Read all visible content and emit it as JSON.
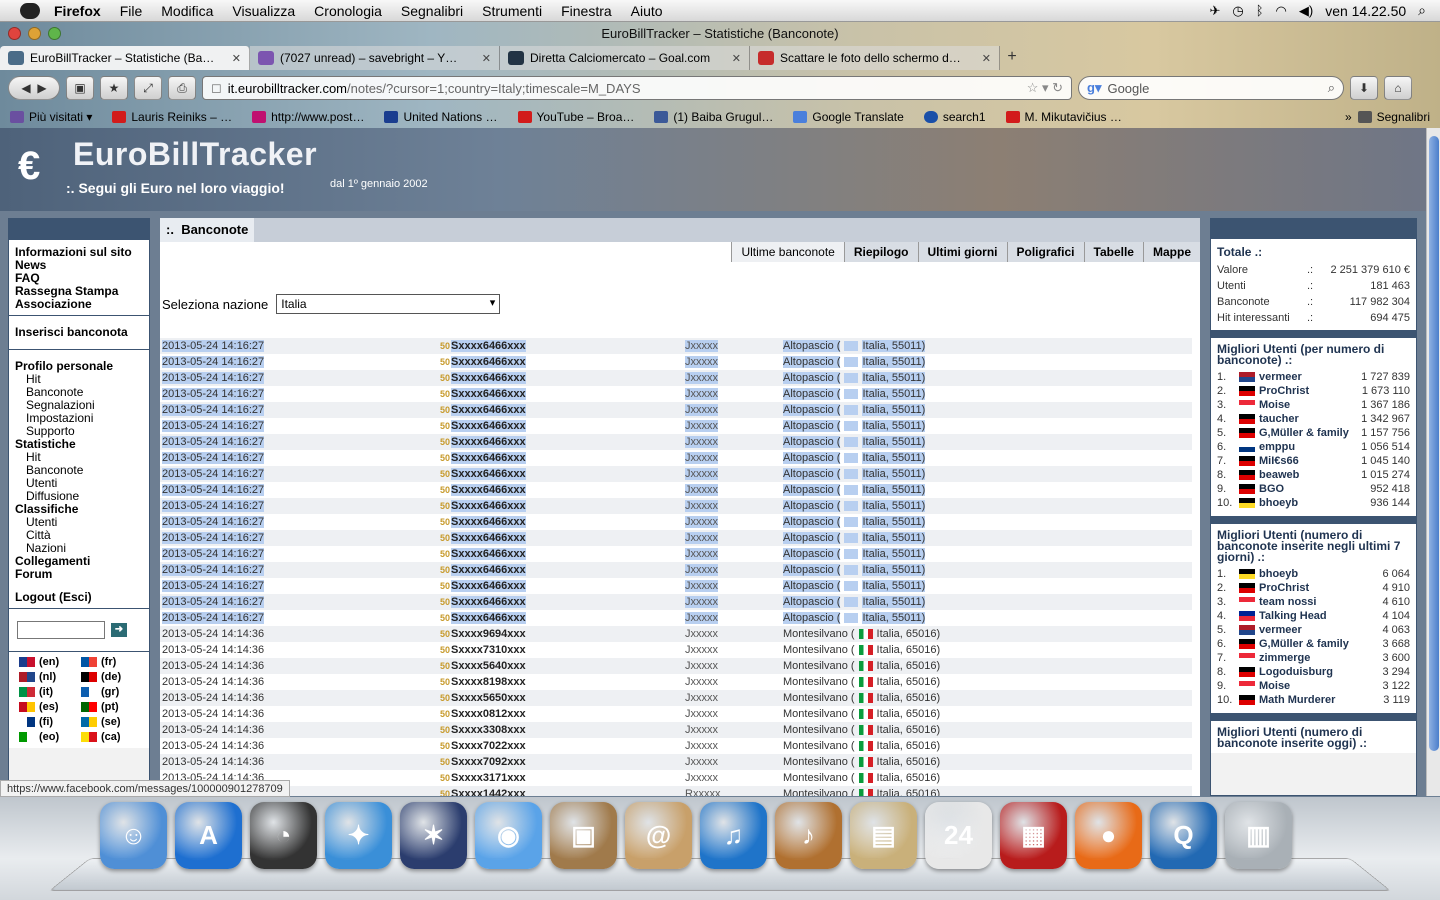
{
  "menubar": {
    "app": "Firefox",
    "items": [
      "File",
      "Modifica",
      "Visualizza",
      "Cronologia",
      "Segnalibri",
      "Strumenti",
      "Finestra",
      "Aiuto"
    ],
    "clock": "ven 14.22.50"
  },
  "window": {
    "title": "EuroBillTracker – Statistiche (Banconote)"
  },
  "tabs": [
    {
      "title": "EuroBillTracker – Statistiche (Ba…",
      "color": "#4b6c88"
    },
    {
      "title": "(7027 unread) – savebright – Y…",
      "color": "#7c55b0"
    },
    {
      "title": "Diretta Calciomercato – Goal.com",
      "color": "#223344"
    },
    {
      "title": "Scattare le foto dello schermo d…",
      "color": "#c62b2b"
    }
  ],
  "newtab": "+",
  "navbar": {
    "url_domain": "it.eurobilltracker.com",
    "url_path": "/notes/?cursor=1;country=Italy;timescale=M_DAYS",
    "search_placeholder": "Google"
  },
  "bookmarks": [
    {
      "label": "Più visitati ▾",
      "color": "#6a4fa0"
    },
    {
      "label": "Lauris Reiniks – …",
      "color": "#d21b1b"
    },
    {
      "label": "http://www.post…",
      "color": "#c01070"
    },
    {
      "label": "United Nations …",
      "color": "#1a3d8f"
    },
    {
      "label": "YouTube – Broa…",
      "color": "#d21b1b"
    },
    {
      "label": "(1) Baiba Grugul…",
      "color": "#3b5998"
    },
    {
      "label": "Google Translate",
      "color": "#4a7fdc"
    },
    {
      "label": "search1",
      "color": "#1a4fa8"
    },
    {
      "label": "M. Mikutavičius …",
      "color": "#d21b1b"
    }
  ],
  "bookmarks_more": "»",
  "bookmarks_menu": "Segnalibri",
  "banner": {
    "brand": "EuroBillTracker",
    "tagline": ":. Segui gli Euro nel loro viaggio!",
    "since": "dal 1º gennaio 2002"
  },
  "leftnav": {
    "info": [
      "Informazioni sul sito",
      "News",
      "FAQ",
      "Rassegna Stampa",
      "Associazione"
    ],
    "insert": "Inserisci banconota",
    "profile_title": "Profilo personale",
    "profile": [
      "Hit",
      "Banconote",
      "Segnalazioni",
      "Impostazioni",
      "Supporto"
    ],
    "stats_title": "Statistiche",
    "stats": [
      "Hit",
      "Banconote",
      "Utenti",
      "Diffusione"
    ],
    "class_title": "Classifiche",
    "classes": [
      "Utenti",
      "Città",
      "Nazioni"
    ],
    "links": [
      "Collegamenti",
      "Forum"
    ],
    "logout": "Logout (Esci)",
    "go": "➜",
    "langs": [
      {
        "code": "(en)",
        "c": [
          "#1b3d8c",
          "#c8102e"
        ]
      },
      {
        "code": "(fr)",
        "c": [
          "#0055a4",
          "#ef4135"
        ]
      },
      {
        "code": "(nl)",
        "c": [
          "#ae1c28",
          "#21468b"
        ]
      },
      {
        "code": "(de)",
        "c": [
          "#000000",
          "#dd0000"
        ]
      },
      {
        "code": "(it)",
        "c": [
          "#009246",
          "#ce2b37"
        ]
      },
      {
        "code": "(gr)",
        "c": [
          "#0d5eaf",
          "#ffffff"
        ]
      },
      {
        "code": "(es)",
        "c": [
          "#c60b1e",
          "#ffc400"
        ]
      },
      {
        "code": "(pt)",
        "c": [
          "#006600",
          "#ff0000"
        ]
      },
      {
        "code": "(fi)",
        "c": [
          "#ffffff",
          "#003580"
        ]
      },
      {
        "code": "(se)",
        "c": [
          "#006aa7",
          "#fecc00"
        ]
      },
      {
        "code": "(eo)",
        "c": [
          "#009900",
          "#ffffff"
        ]
      },
      {
        "code": "(ca)",
        "c": [
          "#fcdd09",
          "#da121a"
        ]
      }
    ]
  },
  "main": {
    "title": "Banconote",
    "prefix": ":.",
    "subtabs": [
      "Ultime banconote",
      "Riepilogo",
      "Ultimi giorni",
      "Poligrafici",
      "Tabelle",
      "Mappe"
    ],
    "select_label": "Seleziona nazione",
    "select_value": "Italia",
    "note_value": "50",
    "rows": [
      {
        "d": "2013-05-24 14:16:27",
        "s": "Sxxxx6466xxx",
        "u": "Jxxxxx",
        "loc": "Altopascio (",
        "cty": "Italia, 55011)",
        "hl": true
      },
      {
        "d": "2013-05-24 14:16:27",
        "s": "Sxxxx6466xxx",
        "u": "Jxxxxx",
        "loc": "Altopascio (",
        "cty": "Italia, 55011)",
        "hl": true
      },
      {
        "d": "2013-05-24 14:16:27",
        "s": "Sxxxx6466xxx",
        "u": "Jxxxxx",
        "loc": "Altopascio (",
        "cty": "Italia, 55011)",
        "hl": true
      },
      {
        "d": "2013-05-24 14:16:27",
        "s": "Sxxxx6466xxx",
        "u": "Jxxxxx",
        "loc": "Altopascio (",
        "cty": "Italia, 55011)",
        "hl": true
      },
      {
        "d": "2013-05-24 14:16:27",
        "s": "Sxxxx6466xxx",
        "u": "Jxxxxx",
        "loc": "Altopascio (",
        "cty": "Italia, 55011)",
        "hl": true
      },
      {
        "d": "2013-05-24 14:16:27",
        "s": "Sxxxx6466xxx",
        "u": "Jxxxxx",
        "loc": "Altopascio (",
        "cty": "Italia, 55011)",
        "hl": true
      },
      {
        "d": "2013-05-24 14:16:27",
        "s": "Sxxxx6466xxx",
        "u": "Jxxxxx",
        "loc": "Altopascio (",
        "cty": "Italia, 55011)",
        "hl": true
      },
      {
        "d": "2013-05-24 14:16:27",
        "s": "Sxxxx6466xxx",
        "u": "Jxxxxx",
        "loc": "Altopascio (",
        "cty": "Italia, 55011)",
        "hl": true
      },
      {
        "d": "2013-05-24 14:16:27",
        "s": "Sxxxx6466xxx",
        "u": "Jxxxxx",
        "loc": "Altopascio (",
        "cty": "Italia, 55011)",
        "hl": true
      },
      {
        "d": "2013-05-24 14:16:27",
        "s": "Sxxxx6466xxx",
        "u": "Jxxxxx",
        "loc": "Altopascio (",
        "cty": "Italia, 55011)",
        "hl": true
      },
      {
        "d": "2013-05-24 14:16:27",
        "s": "Sxxxx6466xxx",
        "u": "Jxxxxx",
        "loc": "Altopascio (",
        "cty": "Italia, 55011)",
        "hl": true
      },
      {
        "d": "2013-05-24 14:16:27",
        "s": "Sxxxx6466xxx",
        "u": "Jxxxxx",
        "loc": "Altopascio (",
        "cty": "Italia, 55011)",
        "hl": true
      },
      {
        "d": "2013-05-24 14:16:27",
        "s": "Sxxxx6466xxx",
        "u": "Jxxxxx",
        "loc": "Altopascio (",
        "cty": "Italia, 55011)",
        "hl": true
      },
      {
        "d": "2013-05-24 14:16:27",
        "s": "Sxxxx6466xxx",
        "u": "Jxxxxx",
        "loc": "Altopascio (",
        "cty": "Italia, 55011)",
        "hl": true
      },
      {
        "d": "2013-05-24 14:16:27",
        "s": "Sxxxx6466xxx",
        "u": "Jxxxxx",
        "loc": "Altopascio (",
        "cty": "Italia, 55011)",
        "hl": true
      },
      {
        "d": "2013-05-24 14:16:27",
        "s": "Sxxxx6466xxx",
        "u": "Jxxxxx",
        "loc": "Altopascio (",
        "cty": "Italia, 55011)",
        "hl": true
      },
      {
        "d": "2013-05-24 14:16:27",
        "s": "Sxxxx6466xxx",
        "u": "Jxxxxx",
        "loc": "Altopascio (",
        "cty": "Italia, 55011)",
        "hl": true
      },
      {
        "d": "2013-05-24 14:16:27",
        "s": "Sxxxx6466xxx",
        "u": "Jxxxxx",
        "loc": "Altopascio (",
        "cty": "Italia, 55011)",
        "hl": true
      },
      {
        "d": "2013-05-24 14:14:36",
        "s": "Sxxxx9694xxx",
        "u": "Jxxxxx",
        "loc": "Montesilvano (",
        "cty": "Italia, 65016)",
        "hl": false
      },
      {
        "d": "2013-05-24 14:14:36",
        "s": "Sxxxx7310xxx",
        "u": "Jxxxxx",
        "loc": "Montesilvano (",
        "cty": "Italia, 65016)",
        "hl": false
      },
      {
        "d": "2013-05-24 14:14:36",
        "s": "Sxxxx5640xxx",
        "u": "Jxxxxx",
        "loc": "Montesilvano (",
        "cty": "Italia, 65016)",
        "hl": false
      },
      {
        "d": "2013-05-24 14:14:36",
        "s": "Sxxxx8198xxx",
        "u": "Jxxxxx",
        "loc": "Montesilvano (",
        "cty": "Italia, 65016)",
        "hl": false
      },
      {
        "d": "2013-05-24 14:14:36",
        "s": "Sxxxx5650xxx",
        "u": "Jxxxxx",
        "loc": "Montesilvano (",
        "cty": "Italia, 65016)",
        "hl": false
      },
      {
        "d": "2013-05-24 14:14:36",
        "s": "Sxxxx0812xxx",
        "u": "Jxxxxx",
        "loc": "Montesilvano (",
        "cty": "Italia, 65016)",
        "hl": false
      },
      {
        "d": "2013-05-24 14:14:36",
        "s": "Sxxxx3308xxx",
        "u": "Jxxxxx",
        "loc": "Montesilvano (",
        "cty": "Italia, 65016)",
        "hl": false
      },
      {
        "d": "2013-05-24 14:14:36",
        "s": "Sxxxx7022xxx",
        "u": "Jxxxxx",
        "loc": "Montesilvano (",
        "cty": "Italia, 65016)",
        "hl": false
      },
      {
        "d": "2013-05-24 14:14:36",
        "s": "Sxxxx7092xxx",
        "u": "Jxxxxx",
        "loc": "Montesilvano (",
        "cty": "Italia, 65016)",
        "hl": false
      },
      {
        "d": "2013-05-24 14:14:36",
        "s": "Sxxxx3171xxx",
        "u": "Jxxxxx",
        "loc": "Montesilvano (",
        "cty": "Italia, 65016)",
        "hl": false
      },
      {
        "d": "2013-05-24 14:14:36",
        "s": "Sxxxx1442xxx",
        "u": "Rxxxxx",
        "loc": "Montesilvano (",
        "cty": "Italia, 65016)",
        "hl": false
      }
    ]
  },
  "right": {
    "totals_title": "Totale .:",
    "sep": ".:",
    "totals": [
      {
        "k": "Valore",
        "v": "2 251 379 610 €"
      },
      {
        "k": "Utenti",
        "v": "181 463"
      },
      {
        "k": "Banconote",
        "v": "117 982 304"
      },
      {
        "k": "Hit interessanti",
        "v": "694 475"
      }
    ],
    "top_title": "Migliori Utenti (per numero di banconote) .:",
    "top": [
      {
        "n": "1.",
        "u": "vermeer",
        "v": "1 727 839",
        "f": [
          "#ae1c28",
          "#21468b"
        ]
      },
      {
        "n": "2.",
        "u": "ProChrist",
        "v": "1 673 110",
        "f": [
          "#000000",
          "#dd0000"
        ]
      },
      {
        "n": "3.",
        "u": "Moise",
        "v": "1 367 186",
        "f": [
          "#ed2939",
          "#ffffff"
        ]
      },
      {
        "n": "4.",
        "u": "taucher",
        "v": "1 342 967",
        "f": [
          "#000000",
          "#dd0000"
        ]
      },
      {
        "n": "5.",
        "u": "G,Müller & family",
        "v": "1 157 756",
        "f": [
          "#000000",
          "#dd0000"
        ]
      },
      {
        "n": "6.",
        "u": "emppu",
        "v": "1 056 514",
        "f": [
          "#ffffff",
          "#003580"
        ]
      },
      {
        "n": "7.",
        "u": "MiI€s66",
        "v": "1 045 140",
        "f": [
          "#000000",
          "#dd0000"
        ]
      },
      {
        "n": "8.",
        "u": "beaweb",
        "v": "1 015 274",
        "f": [
          "#000000",
          "#dd0000"
        ]
      },
      {
        "n": "9.",
        "u": "BGO",
        "v": "952 418",
        "f": [
          "#000000",
          "#dd0000"
        ]
      },
      {
        "n": "10.",
        "u": "bhoeyb",
        "v": "936 144",
        "f": [
          "#000000",
          "#fdda24"
        ]
      }
    ],
    "week_title": "Migliori Utenti (numero di banconote inserite negli ultimi 7 giorni) .:",
    "week": [
      {
        "n": "1.",
        "u": "bhoeyb",
        "v": "6 064",
        "f": [
          "#000000",
          "#fdda24"
        ]
      },
      {
        "n": "2.",
        "u": "ProChrist",
        "v": "4 910",
        "f": [
          "#000000",
          "#dd0000"
        ]
      },
      {
        "n": "3.",
        "u": "team nossi",
        "v": "4 610",
        "f": [
          "#ed2939",
          "#ffffff"
        ]
      },
      {
        "n": "4.",
        "u": "Talking Head",
        "v": "4 104",
        "f": [
          "#002395",
          "#ed2939"
        ]
      },
      {
        "n": "5.",
        "u": "vermeer",
        "v": "4 063",
        "f": [
          "#ae1c28",
          "#21468b"
        ]
      },
      {
        "n": "6.",
        "u": "G,Müller & family",
        "v": "3 668",
        "f": [
          "#000000",
          "#dd0000"
        ]
      },
      {
        "n": "7.",
        "u": "zimmerge",
        "v": "3 600",
        "f": [
          "#ed2939",
          "#ffffff"
        ]
      },
      {
        "n": "8.",
        "u": "Logoduisburg",
        "v": "3 294",
        "f": [
          "#000000",
          "#dd0000"
        ]
      },
      {
        "n": "9.",
        "u": "Moise",
        "v": "3 122",
        "f": [
          "#ed2939",
          "#ffffff"
        ]
      },
      {
        "n": "10.",
        "u": "Math Murderer",
        "v": "3 119",
        "f": [
          "#000000",
          "#dd0000"
        ]
      }
    ],
    "today_title": "Migliori Utenti (numero di banconote inserite oggi) .:"
  },
  "statusbar": "https://www.facebook.com/messages/100000901278709",
  "dock": [
    {
      "name": "finder-icon",
      "c": "#4f8fd6",
      "g": "☺"
    },
    {
      "name": "app-store-icon",
      "c": "#1e6fd0",
      "g": "A"
    },
    {
      "name": "dashboard-icon",
      "c": "#333333",
      "g": "◔"
    },
    {
      "name": "safari-icon",
      "c": "#3a8fd8",
      "g": "✦"
    },
    {
      "name": "imovie-icon",
      "c": "#2b3d6e",
      "g": "✶"
    },
    {
      "name": "facetime-icon",
      "c": "#5aa3e8",
      "g": "◉"
    },
    {
      "name": "iphoto-icon",
      "c": "#a07a4b",
      "g": "▣"
    },
    {
      "name": "address-book-icon",
      "c": "#c8a06a",
      "g": "@"
    },
    {
      "name": "itunes-icon",
      "c": "#1f74c9",
      "g": "♫"
    },
    {
      "name": "garageband-icon",
      "c": "#b07030",
      "g": "♪"
    },
    {
      "name": "preview-icon",
      "c": "#c9b07a",
      "g": "▤"
    },
    {
      "name": "calendar-icon",
      "c": "#e8e8e8",
      "g": "24"
    },
    {
      "name": "photo-booth-icon",
      "c": "#b81c1c",
      "g": "▦"
    },
    {
      "name": "firefox-icon",
      "c": "#e86a17",
      "g": "●"
    },
    {
      "name": "quicktime-icon",
      "c": "#2269b3",
      "g": "Q"
    },
    {
      "name": "trash-icon",
      "c": "#a9b0b6",
      "g": "▥"
    }
  ]
}
